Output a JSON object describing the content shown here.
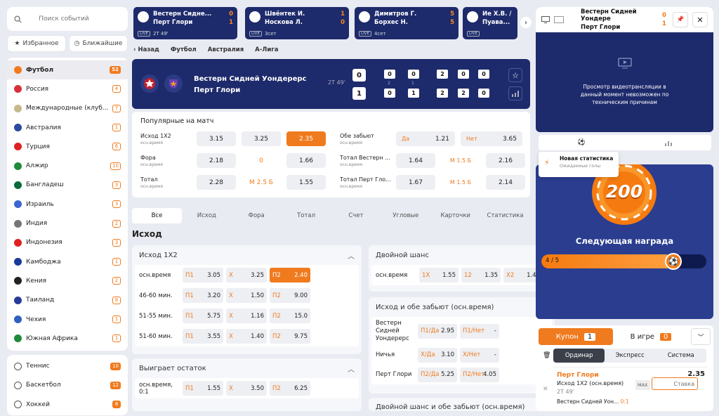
{
  "sidebar": {
    "search_placeholder": "Поиск событий",
    "favorites": "Избранное",
    "upcoming": "Ближайшие",
    "sports": [
      {
        "name": "Футбол",
        "count": "52",
        "color": "#f07a1e"
      },
      {
        "name": "Россия",
        "count": "4",
        "color": "#d8303a"
      },
      {
        "name": "Международные (клуб...",
        "count": "7",
        "color": "#c7b88a"
      },
      {
        "name": "Австралия",
        "count": "1",
        "color": "#2b4aa0"
      },
      {
        "name": "Турция",
        "count": "6",
        "color": "#e02020"
      },
      {
        "name": "Алжир",
        "count": "10",
        "color": "#1e8a3a"
      },
      {
        "name": "Бангладеш",
        "count": "3",
        "color": "#0a6b3a"
      },
      {
        "name": "Израиль",
        "count": "3",
        "color": "#3a66d0"
      },
      {
        "name": "Индия",
        "count": "2",
        "color": "#777"
      },
      {
        "name": "Индонезия",
        "count": "3",
        "color": "#e02020"
      },
      {
        "name": "Камбоджа",
        "count": "1",
        "color": "#1a3a9a"
      },
      {
        "name": "Кения",
        "count": "2",
        "color": "#222"
      },
      {
        "name": "Таиланд",
        "count": "8",
        "color": "#2a3a9a"
      },
      {
        "name": "Чехия",
        "count": "1",
        "color": "#3060c0"
      },
      {
        "name": "Южная Африка",
        "count": "1",
        "color": "#1e8a3a"
      }
    ],
    "other": [
      {
        "name": "Теннис",
        "count": "10"
      },
      {
        "name": "Баскетбол",
        "count": "12"
      },
      {
        "name": "Хоккей",
        "count": "8"
      }
    ]
  },
  "top_matches": [
    {
      "t1": "Вестерн Сидне...",
      "t2": "Перт Глори",
      "s1": "0",
      "s2": "1",
      "meta": "2Т 49'"
    },
    {
      "t1": "Швёнтек И.",
      "t2": "Носкова Л.",
      "s1": "1",
      "s2": "0",
      "meta": "3сет"
    },
    {
      "t1": "Димитров Г.",
      "t2": "Борхес Н.",
      "s1": "5",
      "s2": "5",
      "meta": "4сет"
    },
    {
      "t1": "Ие Х.В. / Л",
      "t2": "Пуава...",
      "s1": "",
      "s2": "",
      "meta": ""
    }
  ],
  "live_label": "LIVE",
  "breadcrumb": {
    "back": "Назад",
    "sport": "Футбол",
    "country": "Австралия",
    "league": "А-Лига"
  },
  "match": {
    "team1": "Вестерн Сидней Уондерерс",
    "team2": "Перт Глори",
    "time": "2Т 49'",
    "score1": "0",
    "score2": "1",
    "period_top": [
      "0",
      "0",
      "2",
      "0",
      "0"
    ],
    "period_bottom": [
      "0",
      "1",
      "2",
      "2",
      "0"
    ],
    "period_labels": [
      "2",
      "1",
      "",
      "",
      ""
    ]
  },
  "popular": {
    "title": "Популярные на матч",
    "sub": "осн.время",
    "rows_left": [
      {
        "label": "Исход 1Х2",
        "cells": [
          "3.15",
          "3.25",
          "2.35"
        ],
        "sel": 2
      },
      {
        "label": "Фора",
        "cells": [
          "2.18",
          "0",
          "1.66"
        ]
      },
      {
        "label": "Тотал",
        "cells": [
          "2.28",
          "М 2.5 Б",
          "1.55"
        ]
      }
    ],
    "rows_right": [
      {
        "label": "Обе забьют",
        "c1l": "Да",
        "c1": "1.21",
        "c2l": "Нет",
        "c2": "3.65"
      },
      {
        "label": "Тотал Вестерн ...",
        "c1": "1.64",
        "mid": "М 1.5 Б",
        "c2": "2.16"
      },
      {
        "label": "Тотал Перт Гло...",
        "c1": "1.67",
        "mid": "М 1.5 Б",
        "c2": "2.14"
      }
    ]
  },
  "tabs": [
    "Все",
    "Исход",
    "Фора",
    "Тотал",
    "Счет",
    "Угловые",
    "Карточки",
    "Статистика"
  ],
  "section_title": "Исход",
  "m1x2": {
    "title": "Исход 1Х2",
    "rows": [
      {
        "p": "осн.время",
        "a": "3.05",
        "b": "3.25",
        "c": "2.40",
        "sel": true
      },
      {
        "p": "46-60 мин.",
        "a": "3.20",
        "b": "1.50",
        "c": "9.00"
      },
      {
        "p": "51-55 мин.",
        "a": "5.75",
        "b": "1.16",
        "c": "15.0"
      },
      {
        "p": "51-60 мин.",
        "a": "3.55",
        "b": "1.40",
        "c": "9.75"
      }
    ]
  },
  "rest": {
    "title": "Выиграет остаток",
    "rows": [
      {
        "p": "осн.время, 0:1",
        "a": "1.55",
        "b": "3.50",
        "c": "6.25"
      }
    ]
  },
  "dbl": {
    "title": "Двойной шанс",
    "rows": [
      {
        "p": "осн.время",
        "a": "1.55",
        "b": "1.35",
        "c": "1.40"
      }
    ]
  },
  "both": {
    "title": "Исход и обе забьют (осн.время)",
    "rows": [
      {
        "p": "Вестерн Сидней Уондерерс",
        "a": "2.95",
        "b": "-"
      },
      {
        "p": "Ничья",
        "a": "3.10",
        "b": "-"
      },
      {
        "p": "Перт Глори",
        "a": "5.25",
        "b": "4.05"
      }
    ]
  },
  "dbl_both_title": "Двойной шанс и обе забьют (осн.время)",
  "labels": {
    "p1": "П1",
    "x": "Х",
    "p2": "П2",
    "x1": "1Х",
    "x12": "12",
    "x2": "Х2",
    "p1y": "П1/Да",
    "p1n": "П1/Нет",
    "xy": "Х/Да",
    "xn": "Х/Нет",
    "p2y": "П2/Да",
    "p2n": "П2/Нет"
  },
  "video": {
    "t1": "Вестерн Сидней Уондере",
    "t2": "Перт Глори",
    "s1": "0",
    "s2": "1",
    "msg": "Просмотр видеотрансляции в данный момент невозможен по техническим причинам"
  },
  "notif": {
    "title": "Новая статистика",
    "sub": "Ожидаемые голы"
  },
  "promo": {
    "amount": "200",
    "title": "Следующая награда",
    "progress": "4 / 5",
    "fraction": 0.8
  },
  "coupon": {
    "tab1": "Купон",
    "n1": "1",
    "tab2": "В игре",
    "n2": "0",
    "types": [
      "Ординар",
      "Экспресс",
      "Система"
    ],
    "team": "Перт Глори",
    "odd": "2.35",
    "market": "Исход 1Х2 (осн.время)",
    "time": "2Т 49'",
    "max": "MAX",
    "stake": "Ставка",
    "match": "Вестерн Сидней Уон...",
    "score": "0:1"
  }
}
